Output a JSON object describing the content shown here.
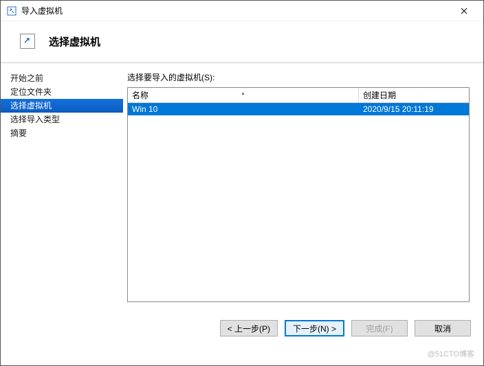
{
  "titlebar": {
    "title": "导入虚拟机"
  },
  "header": {
    "title": "选择虚拟机"
  },
  "sidebar": {
    "items": [
      {
        "label": "开始之前"
      },
      {
        "label": "定位文件夹"
      },
      {
        "label": "选择虚拟机"
      },
      {
        "label": "选择导入类型"
      },
      {
        "label": "摘要"
      }
    ],
    "active_index": 2
  },
  "main": {
    "prompt": "选择要导入的虚拟机(S):",
    "columns": {
      "name": "名称",
      "date": "创建日期"
    },
    "rows": [
      {
        "name": "Win 10",
        "date": "2020/9/15 20:11:19"
      }
    ],
    "selected_index": 0
  },
  "footer": {
    "prev": "< 上一步(P)",
    "next": "下一步(N) >",
    "finish": "完成(F)",
    "cancel": "取消"
  },
  "watermark": "@51CTO博客"
}
